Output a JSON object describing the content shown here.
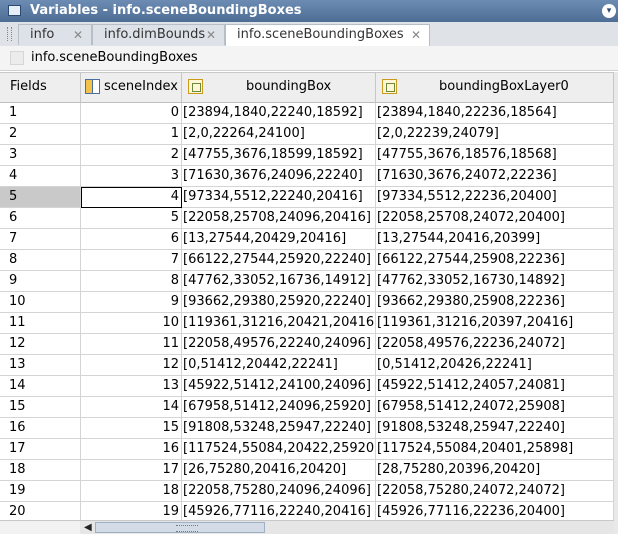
{
  "window": {
    "title": "Variables - info.sceneBoundingBoxes",
    "menu_glyph": "▾"
  },
  "tabs": [
    {
      "label": "info",
      "close": "✕",
      "active": false
    },
    {
      "label": "info.dimBounds",
      "close": "✕",
      "active": false
    },
    {
      "label": "info.sceneBoundingBoxes",
      "close": "✕",
      "active": true
    }
  ],
  "path": {
    "text": "info.sceneBoundingBoxes"
  },
  "grid": {
    "fields_header": "Fields",
    "columns": [
      "sceneIndex",
      "boundingBox",
      "boundingBoxLayer0"
    ],
    "column_icons": [
      "cell-array-icon",
      "struct-field-icon",
      "struct-field-icon"
    ],
    "selected_row": 5,
    "rows": [
      {
        "n": "1",
        "sceneIndex": "0",
        "boundingBox": "[23894,1840,22240,18592]",
        "boundingBoxLayer0": "[23894,1840,22236,18564]"
      },
      {
        "n": "2",
        "sceneIndex": "1",
        "boundingBox": "[2,0,22264,24100]",
        "boundingBoxLayer0": "[2,0,22239,24079]"
      },
      {
        "n": "3",
        "sceneIndex": "2",
        "boundingBox": "[47755,3676,18599,18592]",
        "boundingBoxLayer0": "[47755,3676,18576,18568]"
      },
      {
        "n": "4",
        "sceneIndex": "3",
        "boundingBox": "[71630,3676,24096,22240]",
        "boundingBoxLayer0": "[71630,3676,24072,22236]"
      },
      {
        "n": "5",
        "sceneIndex": "4",
        "boundingBox": "[97334,5512,22240,20416]",
        "boundingBoxLayer0": "[97334,5512,22236,20400]"
      },
      {
        "n": "6",
        "sceneIndex": "5",
        "boundingBox": "[22058,25708,24096,20416]",
        "boundingBoxLayer0": "[22058,25708,24072,20400]"
      },
      {
        "n": "7",
        "sceneIndex": "6",
        "boundingBox": "[13,27544,20429,20416]",
        "boundingBoxLayer0": "[13,27544,20416,20399]"
      },
      {
        "n": "8",
        "sceneIndex": "7",
        "boundingBox": "[66122,27544,25920,22240]",
        "boundingBoxLayer0": "[66122,27544,25908,22236]"
      },
      {
        "n": "9",
        "sceneIndex": "8",
        "boundingBox": "[47762,33052,16736,14912]",
        "boundingBoxLayer0": "[47762,33052,16730,14892]"
      },
      {
        "n": "10",
        "sceneIndex": "9",
        "boundingBox": "[93662,29380,25920,22240]",
        "boundingBoxLayer0": "[93662,29380,25908,22236]"
      },
      {
        "n": "11",
        "sceneIndex": "10",
        "boundingBox": "[119361,31216,20421,20416]",
        "boundingBoxLayer0": "[119361,31216,20397,20416]"
      },
      {
        "n": "12",
        "sceneIndex": "11",
        "boundingBox": "[22058,49576,22240,24096]",
        "boundingBoxLayer0": "[22058,49576,22236,24072]"
      },
      {
        "n": "13",
        "sceneIndex": "12",
        "boundingBox": "[0,51412,20442,22241]",
        "boundingBoxLayer0": "[0,51412,20426,22241]"
      },
      {
        "n": "14",
        "sceneIndex": "13",
        "boundingBox": "[45922,51412,24100,24096]",
        "boundingBoxLayer0": "[45922,51412,24057,24081]"
      },
      {
        "n": "15",
        "sceneIndex": "14",
        "boundingBox": "[67958,51412,24096,25920]",
        "boundingBoxLayer0": "[67958,51412,24072,25908]"
      },
      {
        "n": "16",
        "sceneIndex": "15",
        "boundingBox": "[91808,53248,25947,22240]",
        "boundingBoxLayer0": "[91808,53248,25947,22240]"
      },
      {
        "n": "17",
        "sceneIndex": "16",
        "boundingBox": "[117524,55084,20422,25920]",
        "boundingBoxLayer0": "[117524,55084,20401,25898]"
      },
      {
        "n": "18",
        "sceneIndex": "17",
        "boundingBox": "[26,75280,20416,20420]",
        "boundingBoxLayer0": "[28,75280,20396,20420]"
      },
      {
        "n": "19",
        "sceneIndex": "18",
        "boundingBox": "[22058,75280,24096,24096]",
        "boundingBoxLayer0": "[22058,75280,24072,24072]"
      },
      {
        "n": "20",
        "sceneIndex": "19",
        "boundingBox": "[45926,77116,22240,20416]",
        "boundingBoxLayer0": "[45926,77116,22236,20400]"
      }
    ]
  },
  "scrollbar": {
    "left_arrow": "◀"
  }
}
